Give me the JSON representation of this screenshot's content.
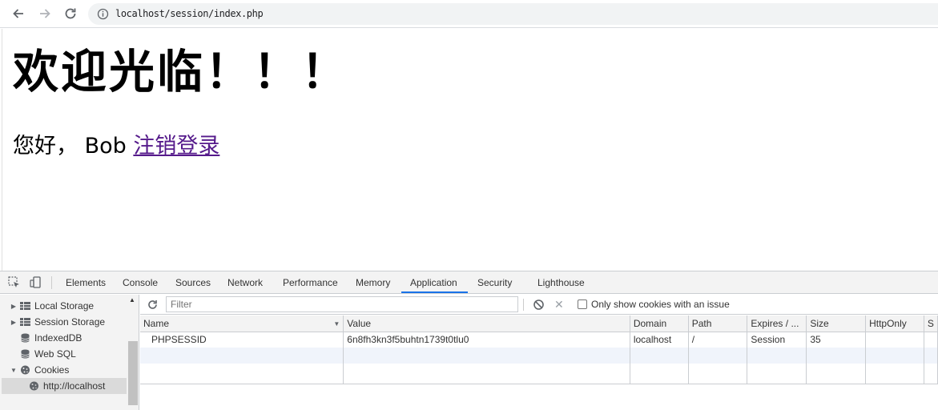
{
  "browser": {
    "url": "localhost/session/index.php"
  },
  "page": {
    "heading": "欢迎光临！！！",
    "greeting": "您好， Bob",
    "logout_link": "注销登录"
  },
  "devtools": {
    "tabs": [
      "Elements",
      "Console",
      "Sources",
      "Network",
      "Performance",
      "Memory",
      "Application",
      "Security",
      "Lighthouse"
    ],
    "active_tab": "Application",
    "sidebar": {
      "items": [
        {
          "label": "Local Storage",
          "icon": "grid-icon",
          "arrow": "▶"
        },
        {
          "label": "Session Storage",
          "icon": "grid-icon",
          "arrow": "▶"
        },
        {
          "label": "IndexedDB",
          "icon": "database-icon",
          "arrow": ""
        },
        {
          "label": "Web SQL",
          "icon": "database-icon",
          "arrow": ""
        },
        {
          "label": "Cookies",
          "icon": "cookie-icon",
          "arrow": "▼"
        },
        {
          "label": "http://localhost",
          "icon": "cookie-icon",
          "arrow": ""
        }
      ]
    },
    "filter": {
      "placeholder": "Filter",
      "checkbox_label": "Only show cookies with an issue"
    },
    "table": {
      "columns": [
        "Name",
        "Value",
        "Domain",
        "Path",
        "Expires / ...",
        "Size",
        "HttpOnly",
        "S"
      ],
      "rows": [
        {
          "name": "PHPSESSID",
          "value": "6n8fh3kn3f5buhtn1739t0tlu0",
          "domain": "localhost",
          "path": "/",
          "expires": "Session",
          "size": "35",
          "httponly": "",
          "secure": ""
        }
      ]
    }
  }
}
